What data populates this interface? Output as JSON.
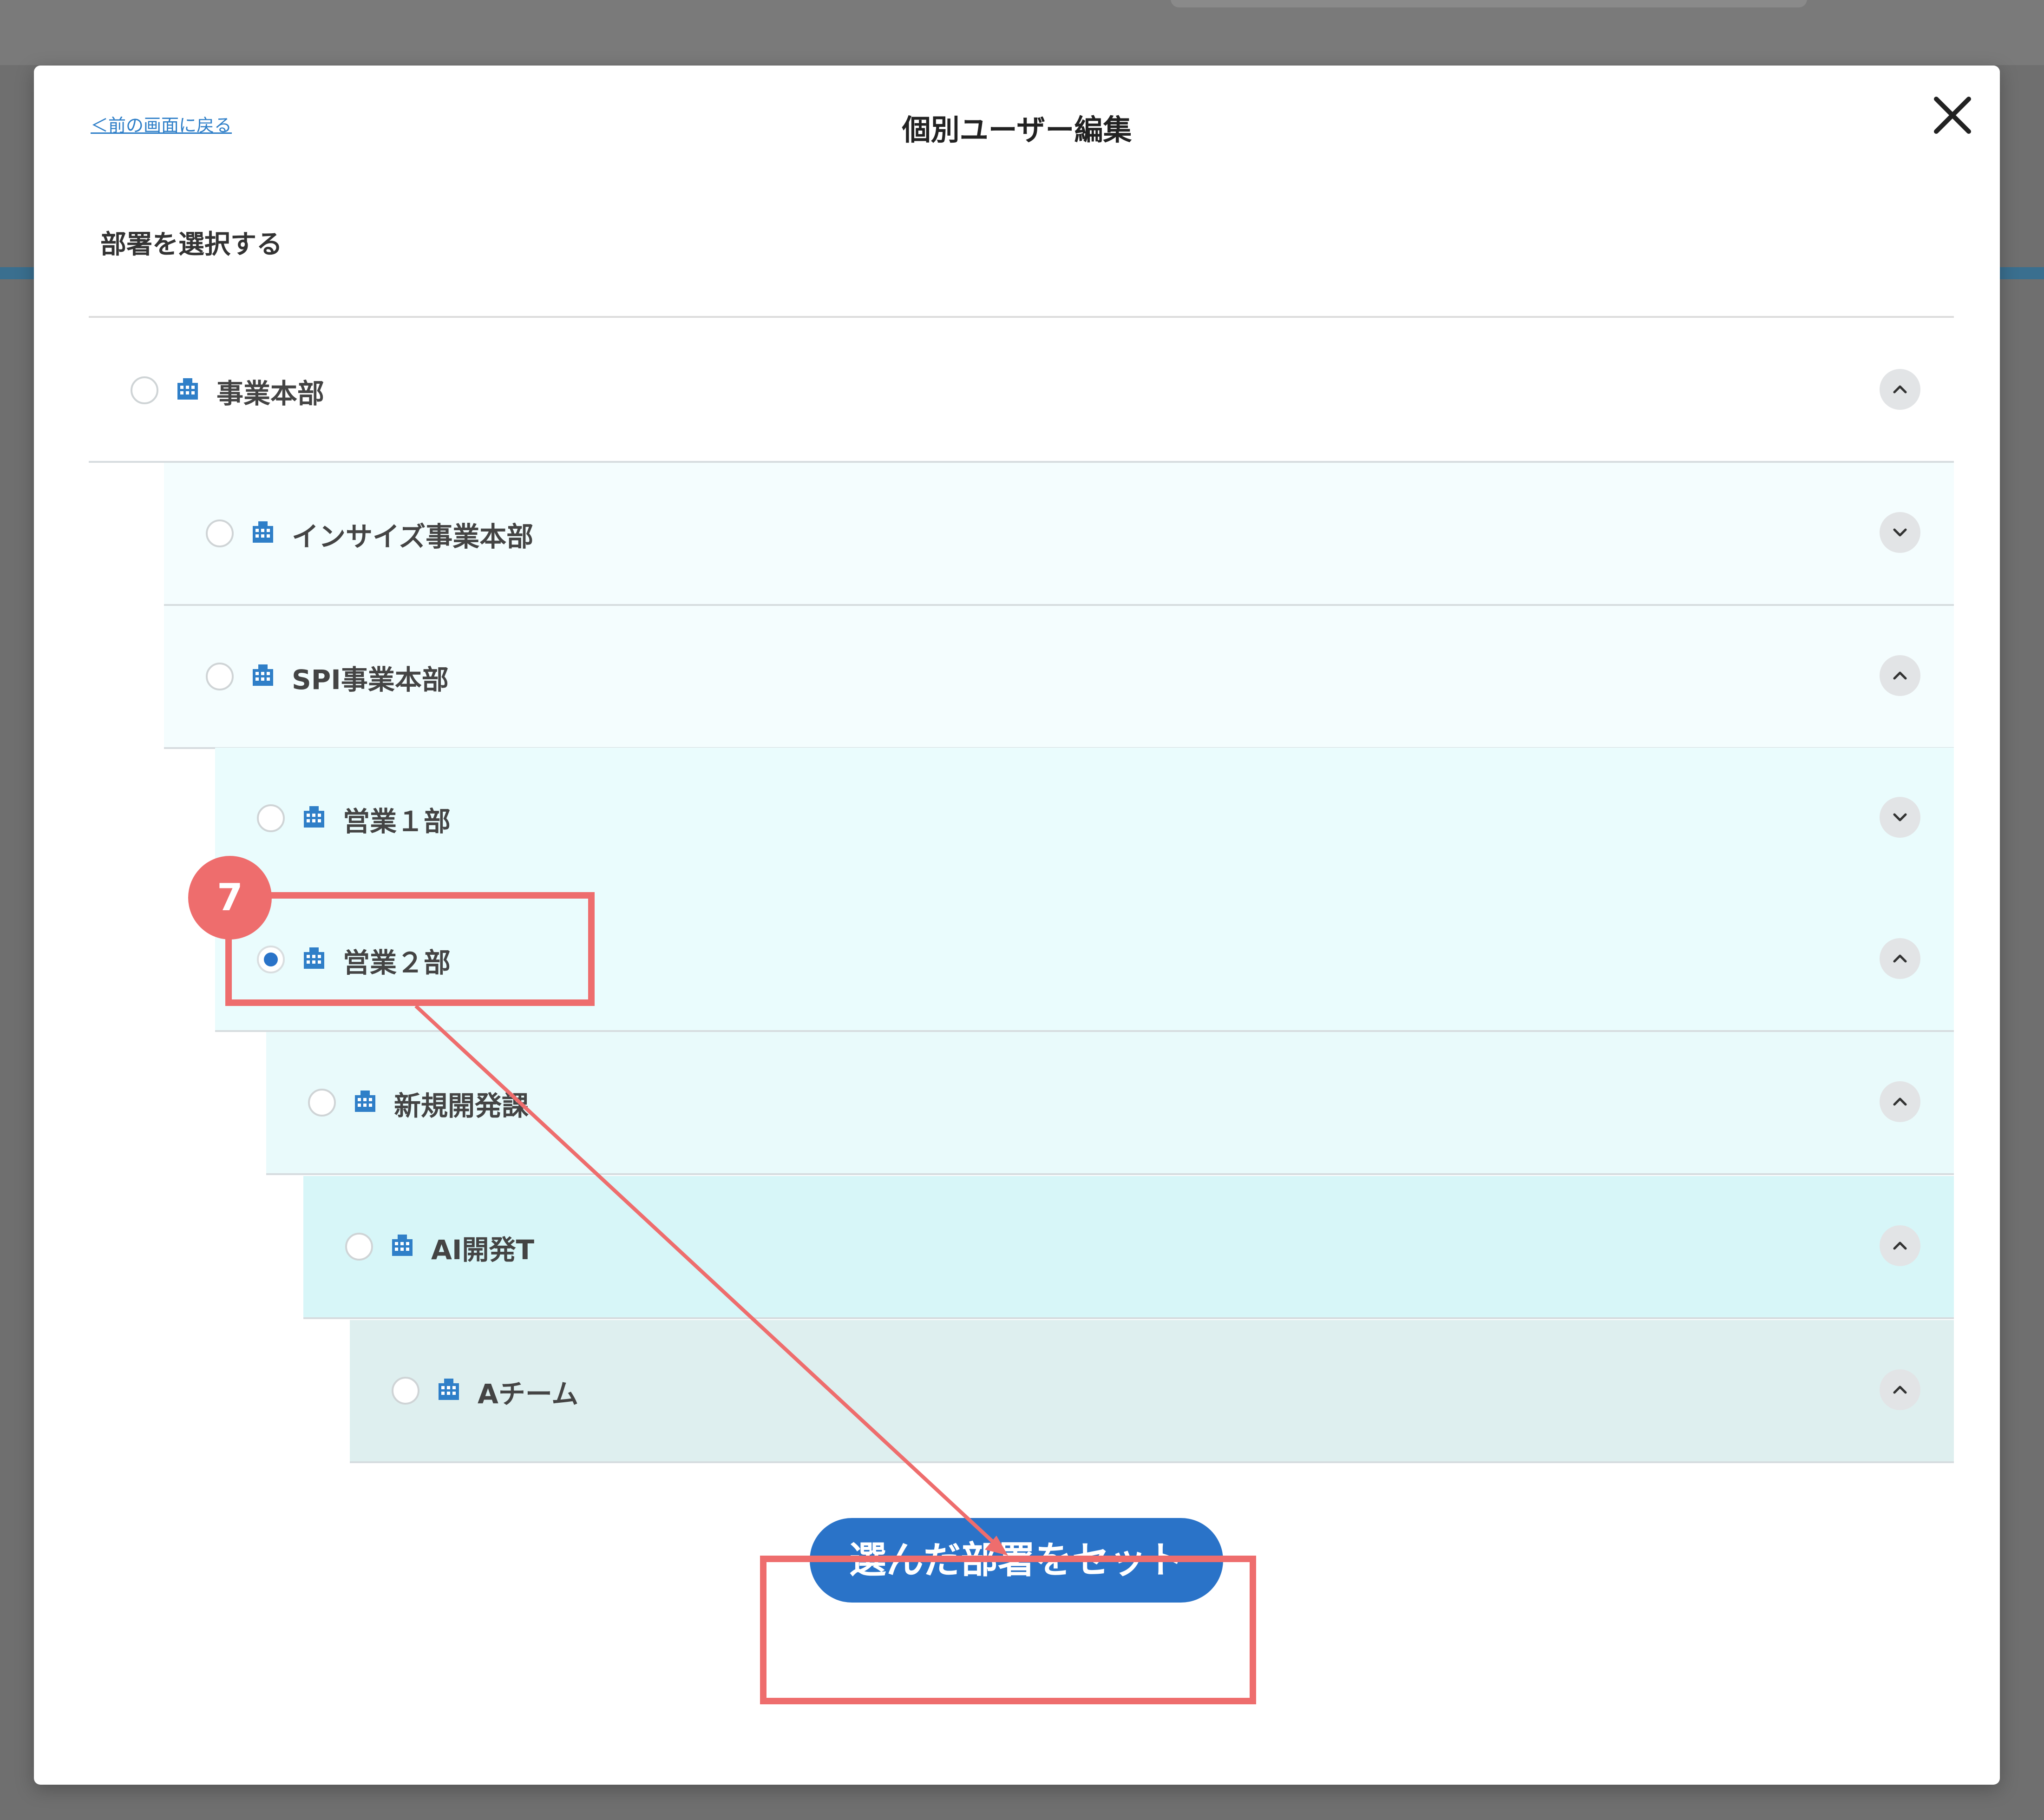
{
  "modal": {
    "back_link": "＜前の画面に戻る",
    "title": "個別ユーザー編集",
    "section_label": "部署を選択する",
    "close_icon": "close-icon"
  },
  "departments": [
    {
      "label": "事業本部",
      "level": 0,
      "selected": false,
      "chevron": "up",
      "bg": "#ffffff"
    },
    {
      "label": "インサイズ事業本部",
      "level": 1,
      "selected": false,
      "chevron": "down",
      "bg": "#f4fdfe"
    },
    {
      "label": "SPI事業本部",
      "level": 1,
      "selected": false,
      "chevron": "up",
      "bg": "#f4fdfe"
    },
    {
      "label": "営業１部",
      "level": 2,
      "selected": false,
      "chevron": "down",
      "bg": "#eafcfd"
    },
    {
      "label": "営業２部",
      "level": 2,
      "selected": true,
      "chevron": "up",
      "bg": "#eafcfd"
    },
    {
      "label": "新規開発課",
      "level": 3,
      "selected": false,
      "chevron": "up",
      "bg": "#e9fafb"
    },
    {
      "label": "AI開発T",
      "level": 4,
      "selected": false,
      "chevron": "up",
      "bg": "#d7f6f8"
    },
    {
      "label": "Aチーム",
      "level": 5,
      "selected": false,
      "chevron": "up",
      "bg": "#deefef"
    }
  ],
  "submit_button": "選んだ部署をセット",
  "annotation": {
    "step_number": "7",
    "color": "#ee6d6d"
  },
  "colors": {
    "primary": "#2a73c8",
    "building_icon": "#2f7fc8"
  }
}
